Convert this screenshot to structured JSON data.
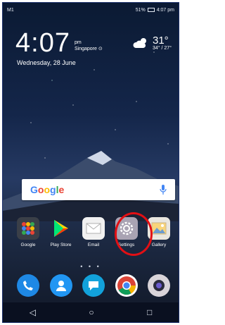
{
  "status_bar": {
    "left": "M1",
    "right": "51%",
    "time": "4:07 pm"
  },
  "clock_widget": {
    "time": "4:07",
    "ampm": "pm",
    "location": "Singapore",
    "date": "Wednesday, 28 June"
  },
  "weather": {
    "temp": "31°",
    "range": "34° / 27°"
  },
  "search": {
    "logo": "Google"
  },
  "apps": [
    {
      "label": "Google"
    },
    {
      "label": "Play Store"
    },
    {
      "label": "Email"
    },
    {
      "label": "Settings"
    },
    {
      "label": "Gallery"
    }
  ],
  "dock": [
    "phone",
    "contacts",
    "messages",
    "chrome",
    "camera"
  ],
  "nav": {
    "back": "◁",
    "home": "○",
    "recent": "□"
  },
  "colors": {
    "highlight": "#e20f14",
    "frame": "#1b2f6b"
  },
  "page_indicator": "• • •"
}
